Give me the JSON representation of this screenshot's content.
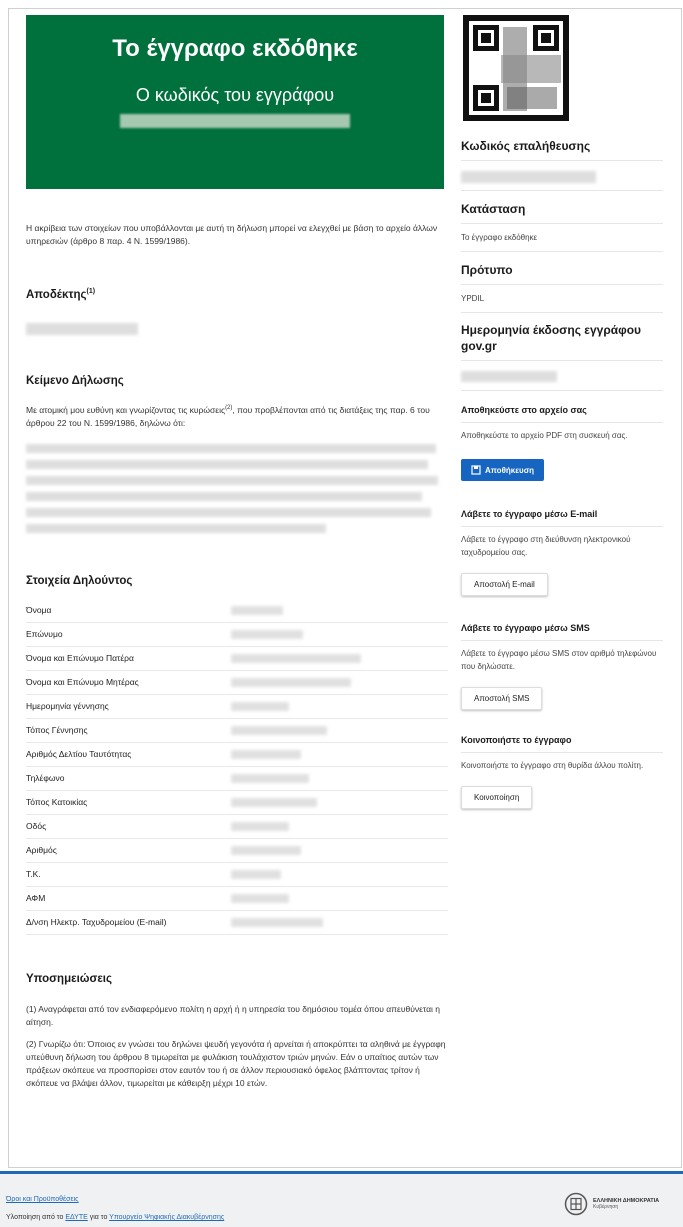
{
  "banner": {
    "title": "Το έγγραφο εκδόθηκε",
    "subtitle": "Ο κωδικός του εγγράφου"
  },
  "intro": "Η ακρίβεια των στοιχείων που υποβάλλονται με αυτή τη δήλωση μπορεί να ελεγχθεί με βάση το αρχείο άλλων υπηρεσιών (άρθρο 8 παρ. 4 Ν. 1599/1986).",
  "recipient": {
    "heading": "Αποδέκτης",
    "sup": "(1)"
  },
  "declaration": {
    "heading": "Κείμενο Δήλωσης",
    "text_before": "Με ατομική μου ευθύνη και γνωρίζοντας τις κυρώσεις",
    "sup": "(2)",
    "text_after": ", που προβλέπονται από τις διατάξεις της παρ. 6 του άρθρου 22 του Ν. 1599/1986, δηλώνω ότι:"
  },
  "declarant": {
    "heading": "Στοιχεία Δηλούντος",
    "rows": [
      {
        "label": "Όνομα"
      },
      {
        "label": "Επώνυμο"
      },
      {
        "label": "Όνομα και Επώνυμο Πατέρα"
      },
      {
        "label": "Όνομα και Επώνυμο Μητέρας"
      },
      {
        "label": "Ημερομηνία γέννησης"
      },
      {
        "label": "Τόπος Γέννησης"
      },
      {
        "label": "Αριθμός Δελτίου Ταυτότητας"
      },
      {
        "label": "Τηλέφωνο"
      },
      {
        "label": "Τόπος Κατοικίας"
      },
      {
        "label": "Οδός"
      },
      {
        "label": "Αριθμός"
      },
      {
        "label": "Τ.Κ."
      },
      {
        "label": "ΑΦΜ"
      },
      {
        "label": "Δ/νση Ηλεκτρ. Ταχυδρομείου (E-mail)"
      }
    ]
  },
  "footnotes": {
    "heading": "Υποσημειώσεις",
    "note1": "(1) Αναγράφεται από τον ενδιαφερόμενο πολίτη η αρχή ή η υπηρεσία του δημόσιου τομέα όπου απευθύνεται η αίτηση.",
    "note2": "(2) Γνωρίζω ότι: Όποιος εν γνώσει του δηλώνει ψευδή γεγονότα ή αρνείται ή αποκρύπτει τα αληθινά με έγγραφη υπεύθυνη δήλωση του άρθρου 8 τιμωρείται με φυλάκιση τουλάχιστον τριών μηνών. Εάν ο υπαίτιος αυτών των πράξεων σκόπευε να προσπορίσει στον εαυτόν του ή σε άλλον περιουσιακό όφελος βλάπτοντας τρίτον ή σκόπευε να βλάψει άλλον, τιμωρείται με κάθειρξη μέχρι 10 ετών."
  },
  "sidebar": {
    "verification_heading": "Κωδικός επαλήθευσης",
    "status_heading": "Κατάσταση",
    "status_value": "Το έγγραφο εκδόθηκε",
    "template_heading": "Πρότυπο",
    "template_value": "YPDIL",
    "issue_date_heading": "Ημερομηνία έκδοσης εγγράφου gov.gr",
    "save": {
      "heading": "Αποθηκεύστε στο αρχείο σας",
      "text": "Αποθηκεύστε το αρχείο PDF στη συσκευή σας.",
      "button": "Αποθήκευση"
    },
    "email": {
      "heading": "Λάβετε το έγγραφο μέσω E-mail",
      "text": "Λάβετε το έγγραφο στη διεύθυνση ηλεκτρονικού ταχυδρομείου σας.",
      "button": "Αποστολή E-mail"
    },
    "sms": {
      "heading": "Λάβετε το έγγραφο μέσω SMS",
      "text": "Λάβετε το έγγραφο μέσω SMS στον αριθμό τηλεφώνου που δηλώσατε.",
      "button": "Αποστολή SMS"
    },
    "share": {
      "heading": "Κοινοποιήστε το έγγραφο",
      "text": "Κοινοποιήστε το έγγραφο στη θυρίδα άλλου πολίτη.",
      "button": "Κοινοποίηση"
    }
  },
  "footer": {
    "terms_link": "Όροι και Προϋποθέσεις",
    "impl_prefix": "Υλοποίηση από το",
    "impl_org": "ΕΔΥΤΕ",
    "impl_mid": "για το",
    "impl_ministry": "Υπουργείο Ψηφιακής Διακυβέρνησης",
    "logo_line1": "ΕΛΛΗΝΙΚΗ ΔΗΜΟΚΡΑΤΙΑ",
    "logo_line2": "Κυβέρνηση"
  },
  "colors": {
    "banner": "#00703c",
    "primary": "#1665c1",
    "footer_border": "#1f6ab5"
  },
  "icons": {
    "save": "save-file-icon",
    "qr": "qr-code-icon",
    "emblem": "greek-emblem-icon"
  }
}
